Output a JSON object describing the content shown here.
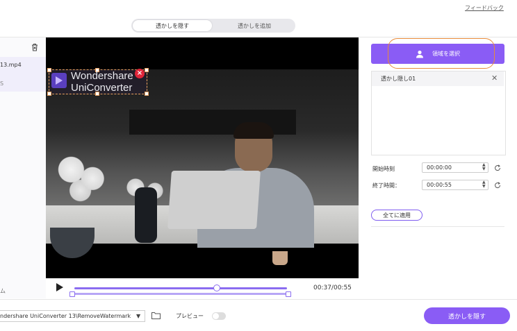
{
  "header": {
    "feedback_link": "フィードバック",
    "tabs": [
      {
        "label": "透かしを隠す",
        "active": true
      },
      {
        "label": "透かしを追加",
        "active": false
      }
    ]
  },
  "left_panel": {
    "file_name": "13.mp4",
    "file_sub": "S",
    "bottom_text": "ム"
  },
  "video": {
    "watermark_line1": "Wondershare",
    "watermark_line2": "UniConverter",
    "current_time": "00:37",
    "total_time": "00:55",
    "time_display": "00:37/00:55",
    "progress_fraction": 0.67
  },
  "right_panel": {
    "select_area_button": "領域を選択",
    "list_item_label": "透かし隠し01",
    "start_label": "開始時刻",
    "start_value": "00:00:00",
    "end_label": "終了時間：",
    "end_value": "00:00:55",
    "apply_all_button": "全てに適用"
  },
  "bottom_bar": {
    "output_path": "ndershare UniConverter 13\\RemoveWatermark",
    "preview_label": "プレビュー",
    "preview_enabled": false,
    "remove_button": "透かしを隠す"
  },
  "colors": {
    "accent": "#8a5cf5",
    "highlight_outline": "#e88a3a",
    "watermark_close": "#e0263a"
  },
  "icons": [
    "trash-icon",
    "play-icon",
    "user-icon",
    "close-icon",
    "spin-up-icon",
    "spin-down-icon",
    "reset-icon",
    "folder-icon",
    "chevron-down-icon"
  ]
}
